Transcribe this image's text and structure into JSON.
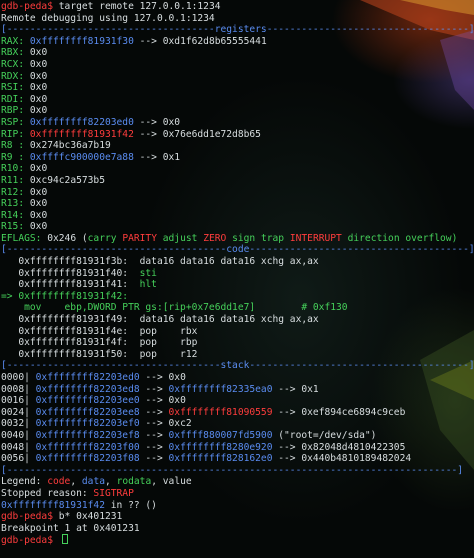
{
  "colors": {
    "green": "#45d05a",
    "white": "#d8dee0",
    "blue": "#5a8cf0",
    "red": "#ff3d3d",
    "yellow": "#e6c84a",
    "magenta": "#e052e0",
    "cyan": "#3fc2c8"
  },
  "terminal": {
    "lines": [
      [
        [
          "gdb-peda$ ",
          "r"
        ],
        [
          "target remote 127.0.0.1:1234",
          "w"
        ]
      ],
      [
        [
          "Remote debugging using 127.0.0.1:1234",
          "w"
        ]
      ],
      [
        [
          "[------------------------------------registers-----------------------------------]",
          "b"
        ]
      ],
      [
        [
          "RAX: ",
          "g"
        ],
        [
          "0xffffffff81931f30",
          "b"
        ],
        [
          " --> ",
          "w"
        ],
        [
          "0xd1f62d8b65555441",
          "w"
        ]
      ],
      [
        [
          "RBX: ",
          "g"
        ],
        [
          "0x0",
          "w"
        ]
      ],
      [
        [
          "RCX: ",
          "g"
        ],
        [
          "0x0",
          "w"
        ]
      ],
      [
        [
          "RDX: ",
          "g"
        ],
        [
          "0x0",
          "w"
        ]
      ],
      [
        [
          "RSI: ",
          "g"
        ],
        [
          "0x0",
          "w"
        ]
      ],
      [
        [
          "RDI: ",
          "g"
        ],
        [
          "0x0",
          "w"
        ]
      ],
      [
        [
          "RBP: ",
          "g"
        ],
        [
          "0x0",
          "w"
        ]
      ],
      [
        [
          "RSP: ",
          "g"
        ],
        [
          "0xffffffff82203ed0",
          "b"
        ],
        [
          " --> ",
          "w"
        ],
        [
          "0x0",
          "w"
        ]
      ],
      [
        [
          "RIP: ",
          "g"
        ],
        [
          "0xffffffff81931f42",
          "r"
        ],
        [
          " --> ",
          "w"
        ],
        [
          "0x76e6dd1e72d8b65",
          "w"
        ]
      ],
      [
        [
          "R8 : ",
          "g"
        ],
        [
          "0x274bc36a7b19",
          "w"
        ]
      ],
      [
        [
          "R9 : ",
          "g"
        ],
        [
          "0xffffc900000e7a88",
          "b"
        ],
        [
          " --> ",
          "w"
        ],
        [
          "0x1",
          "w"
        ]
      ],
      [
        [
          "R10: ",
          "g"
        ],
        [
          "0x0",
          "w"
        ]
      ],
      [
        [
          "R11: ",
          "g"
        ],
        [
          "0xc94c2a573b5",
          "w"
        ]
      ],
      [
        [
          "R12: ",
          "g"
        ],
        [
          "0x0",
          "w"
        ]
      ],
      [
        [
          "R13: ",
          "g"
        ],
        [
          "0x0",
          "w"
        ]
      ],
      [
        [
          "R14: ",
          "g"
        ],
        [
          "0x0",
          "w"
        ]
      ],
      [
        [
          "R15: ",
          "g"
        ],
        [
          "0x0",
          "w"
        ]
      ],
      [
        [
          "EFLAGS: ",
          "g"
        ],
        [
          "0x246 (",
          "w"
        ],
        [
          "carry ",
          "g"
        ],
        [
          "PARITY ",
          "r"
        ],
        [
          "adjust ",
          "g"
        ],
        [
          "ZERO ",
          "r"
        ],
        [
          "sign trap ",
          "g"
        ],
        [
          "INTERRUPT ",
          "r"
        ],
        [
          "direction overflow)",
          "g"
        ]
      ],
      [
        [
          "[--------------------------------------code--------------------------------------]",
          "b"
        ]
      ],
      [
        [
          "   0xffffffff81931f3b:  ",
          "w"
        ],
        [
          "data16 data16 data16 xchg ax,ax",
          "w"
        ]
      ],
      [
        [
          "   0xffffffff81931f40:  ",
          "w"
        ],
        [
          "sti",
          "g"
        ]
      ],
      [
        [
          "   0xffffffff81931f41:  ",
          "w"
        ],
        [
          "hlt",
          "g"
        ]
      ],
      [
        [
          "=> 0xffffffff81931f42:",
          "g"
        ]
      ],
      [
        [
          "    mov    ebp,DWORD PTR gs:[rip+0x7e6dd1e7]        # 0xf130",
          "g"
        ]
      ],
      [
        [
          "   0xffffffff81931f49:  ",
          "w"
        ],
        [
          "data16 data16 data16 xchg ax,ax",
          "w"
        ]
      ],
      [
        [
          "   0xffffffff81931f4e:  ",
          "w"
        ],
        [
          "pop    rbx",
          "w"
        ]
      ],
      [
        [
          "   0xffffffff81931f4f:  ",
          "w"
        ],
        [
          "pop    rbp",
          "w"
        ]
      ],
      [
        [
          "   0xffffffff81931f50:  ",
          "w"
        ],
        [
          "pop    r12",
          "w"
        ]
      ],
      [
        [
          "[-------------------------------------stack--------------------------------------]",
          "b"
        ]
      ],
      [
        [
          "0000| ",
          "w"
        ],
        [
          "0xffffffff82203ed0",
          "b"
        ],
        [
          " --> ",
          "w"
        ],
        [
          "0x0",
          "w"
        ]
      ],
      [
        [
          "0008| ",
          "w"
        ],
        [
          "0xffffffff82203ed8",
          "b"
        ],
        [
          " --> ",
          "w"
        ],
        [
          "0xffffffff82335ea0",
          "b"
        ],
        [
          " --> ",
          "w"
        ],
        [
          "0x1",
          "w"
        ]
      ],
      [
        [
          "0016| ",
          "w"
        ],
        [
          "0xffffffff82203ee0",
          "b"
        ],
        [
          " --> ",
          "w"
        ],
        [
          "0x0",
          "w"
        ]
      ],
      [
        [
          "0024| ",
          "w"
        ],
        [
          "0xffffffff82203ee8",
          "b"
        ],
        [
          " --> ",
          "w"
        ],
        [
          "0xffffffff81090559",
          "r"
        ],
        [
          " --> ",
          "w"
        ],
        [
          "0xef894ce6894c9ceb",
          "w"
        ]
      ],
      [
        [
          "0032| ",
          "w"
        ],
        [
          "0xffffffff82203ef0",
          "b"
        ],
        [
          " --> ",
          "w"
        ],
        [
          "0xc2",
          "w"
        ]
      ],
      [
        [
          "0040| ",
          "w"
        ],
        [
          "0xffffffff82203ef8",
          "b"
        ],
        [
          " --> ",
          "w"
        ],
        [
          "0xffff880007fd5900",
          "b"
        ],
        [
          " (\"root=/dev/sda\")",
          "w"
        ]
      ],
      [
        [
          "0048| ",
          "w"
        ],
        [
          "0xffffffff82203f00",
          "b"
        ],
        [
          " --> ",
          "w"
        ],
        [
          "0xffffffff8280e920",
          "b"
        ],
        [
          " --> ",
          "w"
        ],
        [
          "0x82048d4810422305",
          "w"
        ]
      ],
      [
        [
          "0056| ",
          "w"
        ],
        [
          "0xffffffff82203f08",
          "b"
        ],
        [
          " --> ",
          "w"
        ],
        [
          "0xffffffff828162e0",
          "b"
        ],
        [
          " --> ",
          "w"
        ],
        [
          "0x440b4810189482024",
          "w"
        ]
      ],
      [
        [
          "[------------------------------------------------------------------------------]",
          "b"
        ]
      ],
      [
        [
          "Legend: ",
          "w"
        ],
        [
          "code",
          "r"
        ],
        [
          ", ",
          "w"
        ],
        [
          "data",
          "b"
        ],
        [
          ", ",
          "w"
        ],
        [
          "rodata",
          "g"
        ],
        [
          ", value",
          "w"
        ]
      ],
      [
        [
          "Stopped reason: ",
          "w"
        ],
        [
          "SIGTRAP",
          "r"
        ]
      ],
      [
        [
          "0xffffffff81931f42",
          "b"
        ],
        [
          " in ?? ()",
          "w"
        ]
      ],
      [
        [
          "gdb-peda$ ",
          "r"
        ],
        [
          "b* 0x401231",
          "w"
        ]
      ],
      [
        [
          "Breakpoint 1 at 0x401231",
          "w"
        ]
      ],
      [
        [
          "gdb-peda$ ",
          "r"
        ]
      ]
    ]
  }
}
